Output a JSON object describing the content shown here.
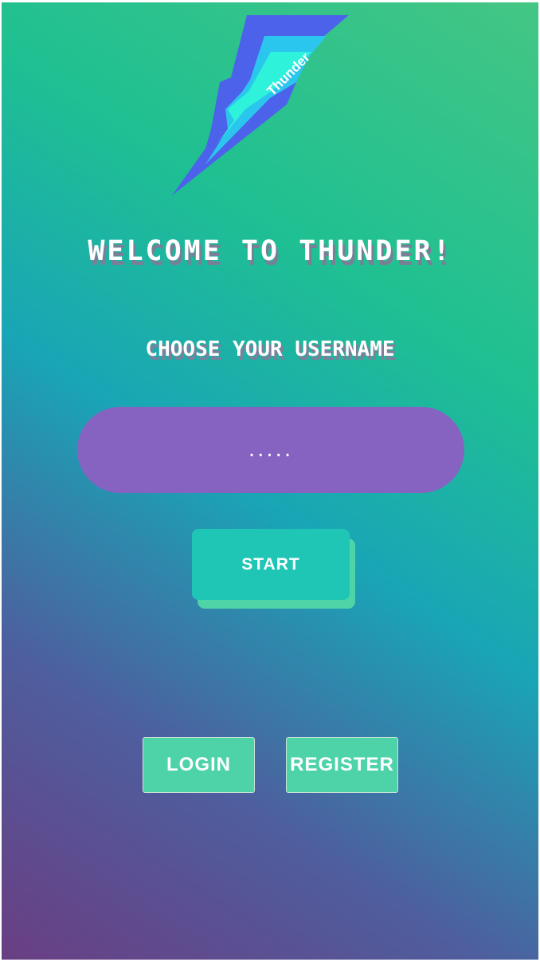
{
  "logo": {
    "icon": "lightning-bolt-icon",
    "text": "Thunder",
    "colors": {
      "outer": "#4c62ea",
      "middle": "#2bc6ee",
      "inner": "#2ef2da"
    }
  },
  "welcome": {
    "title": "WELCOME TO THUNDER!"
  },
  "username": {
    "label": "CHOOSE YOUR USERNAME",
    "value": "....."
  },
  "actions": {
    "start_label": "START",
    "login_label": "LOGIN",
    "register_label": "REGISTER"
  },
  "colors": {
    "gradient_top_right": "#44c684",
    "gradient_bottom_left": "#6a3e83",
    "input_bg": "#8663c1",
    "start_bg": "#20c6b5",
    "button_bg": "#4ed3a9"
  }
}
